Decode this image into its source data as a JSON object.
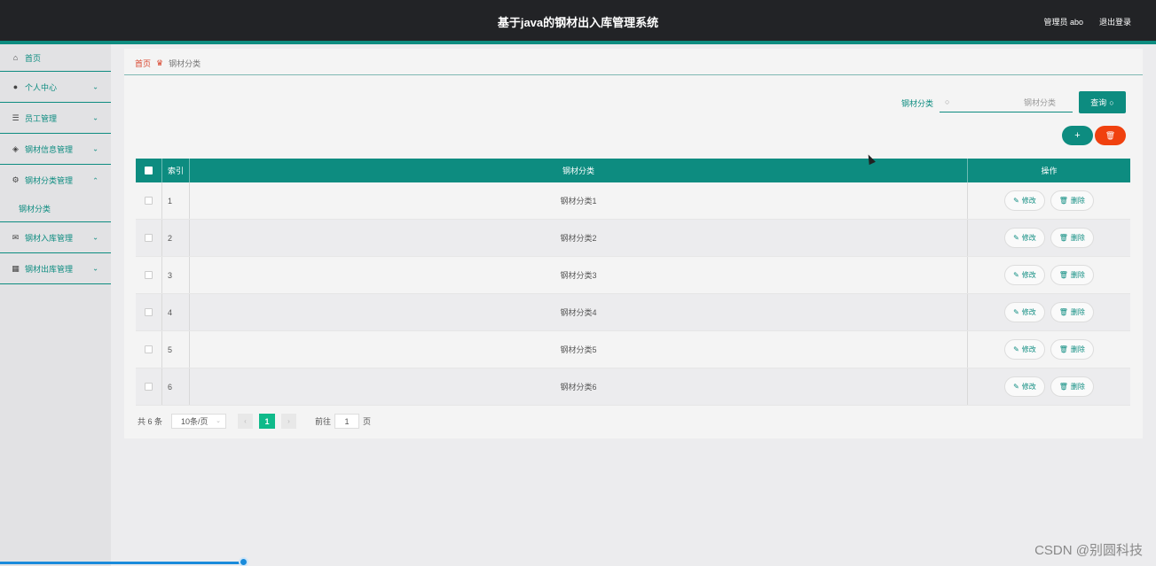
{
  "header": {
    "title": "基于java的钢材出入库管理系统",
    "user_label": "管理员 abo",
    "logout_label": "退出登录"
  },
  "sidebar": {
    "items": [
      {
        "label": "首页",
        "icon": "home-icon"
      },
      {
        "label": "个人中心",
        "icon": "person-icon"
      },
      {
        "label": "员工管理",
        "icon": "list-icon"
      },
      {
        "label": "钢材信息管理",
        "icon": "shield-icon"
      },
      {
        "label": "钢材分类管理",
        "icon": "settings-icon",
        "expanded": true,
        "sub": "钢材分类"
      },
      {
        "label": "钢材入库管理",
        "icon": "mail-icon"
      },
      {
        "label": "钢材出库管理",
        "icon": "grid-icon"
      }
    ]
  },
  "breadcrumb": {
    "home": "首页",
    "current": "钢材分类"
  },
  "search": {
    "label": "钢材分类",
    "placeholder": "钢材分类",
    "button": "查询"
  },
  "actions": {
    "add": "+",
    "delete_icon": "trash-icon"
  },
  "table": {
    "headers": [
      "索引",
      "钢材分类",
      "操作"
    ],
    "rows": [
      {
        "index": "1",
        "name": "钢材分类1"
      },
      {
        "index": "2",
        "name": "钢材分类2"
      },
      {
        "index": "3",
        "name": "钢材分类3"
      },
      {
        "index": "4",
        "name": "钢材分类4"
      },
      {
        "index": "5",
        "name": "钢材分类5"
      },
      {
        "index": "6",
        "name": "钢材分类6"
      }
    ],
    "edit_label": "修改",
    "delete_label": "删除"
  },
  "pagination": {
    "total": "共 6 条",
    "page_size": "10条/页",
    "current_page": "1",
    "goto_prefix": "前往",
    "goto_value": "1",
    "goto_suffix": "页"
  },
  "watermark": "CSDN @别圆科技",
  "colors": {
    "accent": "#0d8c80",
    "danger": "#f0410f",
    "page_active": "#0fba8a",
    "header_bg": "#222326"
  },
  "progress": 0.21
}
